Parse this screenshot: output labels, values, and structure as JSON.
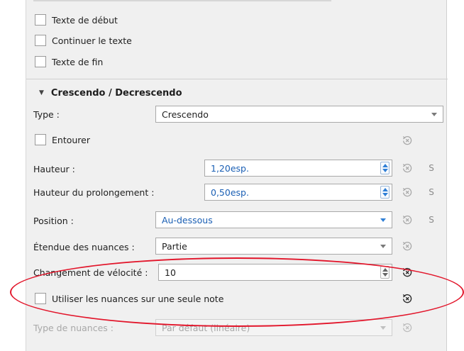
{
  "text_options": {
    "start_text": "Texte de début",
    "continue_text": "Continuer le texte",
    "end_text": "Texte de fin"
  },
  "section": {
    "title": "Crescendo / Decrescendo",
    "expanded_icon": "triangle-down-icon"
  },
  "type": {
    "label": "Type :",
    "value": "Crescendo"
  },
  "frame": {
    "label": "Entourer",
    "checked": false
  },
  "height": {
    "label": "Hauteur :",
    "value": "1,20esp."
  },
  "continue_height": {
    "label": "Hauteur du prolongement :",
    "value": "0,50esp."
  },
  "position": {
    "label": "Position :",
    "value": "Au-dessous"
  },
  "dynamic_range": {
    "label": "Étendue des nuances :",
    "value": "Partie"
  },
  "velocity_change": {
    "label": "Changement de vélocité :",
    "value": "10"
  },
  "single_note": {
    "label": "Utiliser les nuances sur une seule note",
    "checked": false
  },
  "dynamic_type": {
    "label": "Type de nuances :",
    "value": "Par défaut (linéaire)"
  },
  "style_button": "S",
  "colors": {
    "accent_blue": "#1a5fb4",
    "annotation_red": "#e2162b"
  }
}
